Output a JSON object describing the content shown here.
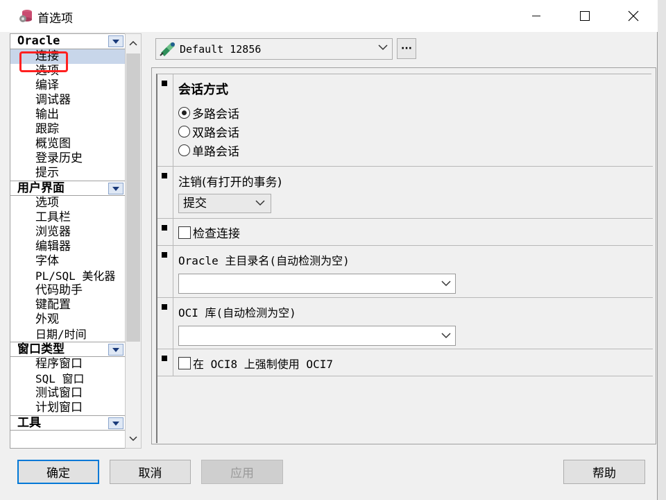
{
  "window": {
    "title": "首选项",
    "controls": {
      "minimize": "minimize",
      "maximize": "maximize",
      "close": "close"
    }
  },
  "sidebar": {
    "categories": [
      {
        "label": "Oracle",
        "items": [
          "连接",
          "选项",
          "编译",
          "调试器",
          "输出",
          "跟踪",
          "概览图",
          "登录历史",
          "提示"
        ]
      },
      {
        "label": "用户界面",
        "items": [
          "选项",
          "工具栏",
          "浏览器",
          "编辑器",
          "字体",
          "PL/SQL 美化器",
          "代码助手",
          "键配置",
          "外观",
          "日期/时间"
        ]
      },
      {
        "label": "窗口类型",
        "items": [
          "程序窗口",
          "SQL 窗口",
          "测试窗口",
          "计划窗口"
        ]
      },
      {
        "label": "工具",
        "items": []
      }
    ],
    "selected": "连接"
  },
  "profile": {
    "value": "Default 12856",
    "more_label": "···"
  },
  "sections": {
    "session_mode": {
      "title": "会话方式",
      "options": [
        "多路会话",
        "双路会话",
        "单路会话"
      ],
      "selected_index": 0
    },
    "logoff": {
      "label": "注销(有打开的事务)",
      "value": "提交"
    },
    "check_connection": {
      "label": "检查连接",
      "checked": false
    },
    "oracle_home": {
      "label": "Oracle 主目录名(自动检测为空)",
      "value": ""
    },
    "oci_library": {
      "label": "OCI 库(自动检测为空)",
      "value": ""
    },
    "force_oci7": {
      "label": "在 OCI8 上强制使用 OCI7",
      "checked": false
    }
  },
  "buttons": {
    "ok": "确定",
    "cancel": "取消",
    "apply": "应用",
    "help": "帮助"
  }
}
